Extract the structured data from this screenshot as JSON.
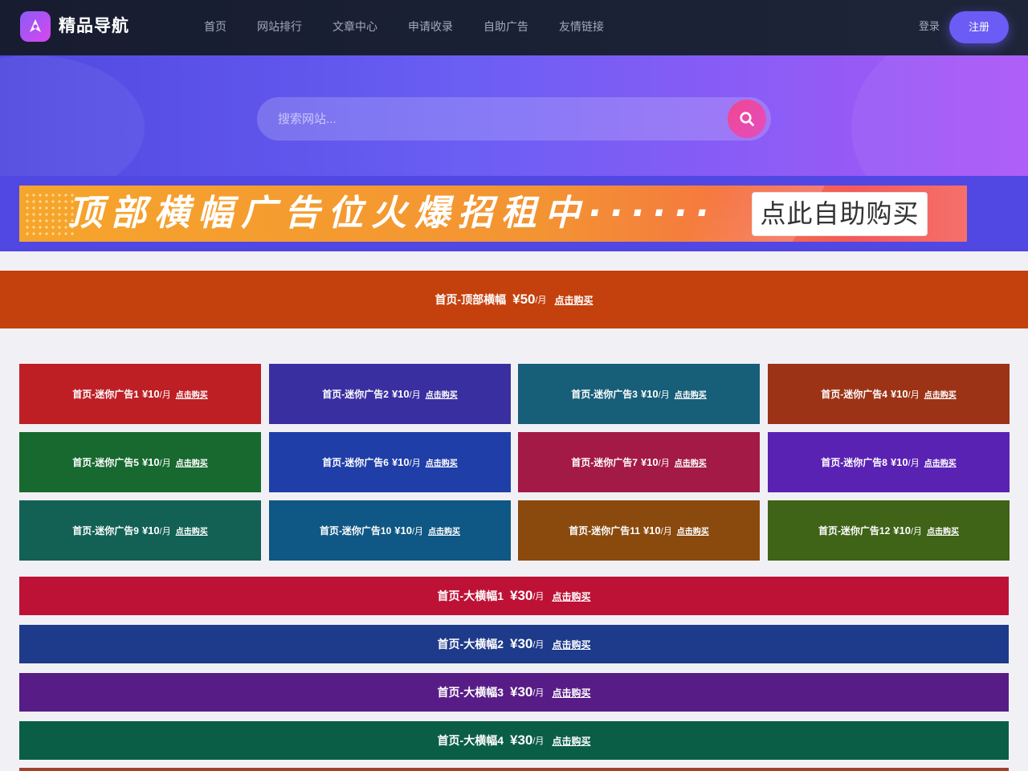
{
  "brand": {
    "name": "精品导航",
    "logo_icon": "rocket-icon",
    "logo_gradient": [
      "#8b5cf6",
      "#d946ef"
    ]
  },
  "nav": {
    "items": [
      "首页",
      "网站排行",
      "文章中心",
      "申请收录",
      "自助广告",
      "友情链接"
    ],
    "login_label": "登录",
    "register_label": "注册"
  },
  "search": {
    "placeholder": "搜索网站...",
    "value": "",
    "button_icon": "search-icon"
  },
  "top_banner": {
    "headline": "顶部横幅广告位火爆招租中······",
    "cta": "点此自助购买"
  },
  "full_banner": {
    "title": "首页-顶部横幅",
    "price": "¥50",
    "unit": "/月",
    "buy": "点击购买",
    "color": "#c4410e"
  },
  "mini_ads": [
    {
      "title": "首页-迷你广告1",
      "price": "¥10",
      "unit": "/月",
      "buy": "点击购买",
      "color": "#bd1f25"
    },
    {
      "title": "首页-迷你广告2",
      "price": "¥10",
      "unit": "/月",
      "buy": "点击购买",
      "color": "#3a2fa1"
    },
    {
      "title": "首页-迷你广告3",
      "price": "¥10",
      "unit": "/月",
      "buy": "点击购买",
      "color": "#175e79"
    },
    {
      "title": "首页-迷你广告4",
      "price": "¥10",
      "unit": "/月",
      "buy": "点击购买",
      "color": "#9d3316"
    },
    {
      "title": "首页-迷你广告5",
      "price": "¥10",
      "unit": "/月",
      "buy": "点击购买",
      "color": "#17692f"
    },
    {
      "title": "首页-迷你广告6",
      "price": "¥10",
      "unit": "/月",
      "buy": "点击购买",
      "color": "#1f3ea8"
    },
    {
      "title": "首页-迷你广告7",
      "price": "¥10",
      "unit": "/月",
      "buy": "点击购买",
      "color": "#a31a46"
    },
    {
      "title": "首页-迷你广告8",
      "price": "¥10",
      "unit": "/月",
      "buy": "点击购买",
      "color": "#5a22b3"
    },
    {
      "title": "首页-迷你广告9",
      "price": "¥10",
      "unit": "/月",
      "buy": "点击购买",
      "color": "#126154"
    },
    {
      "title": "首页-迷你广告10",
      "price": "¥10",
      "unit": "/月",
      "buy": "点击购买",
      "color": "#0f5784"
    },
    {
      "title": "首页-迷你广告11",
      "price": "¥10",
      "unit": "/月",
      "buy": "点击购买",
      "color": "#8a4a0e"
    },
    {
      "title": "首页-迷你广告12",
      "price": "¥10",
      "unit": "/月",
      "buy": "点击购买",
      "color": "#3f6317"
    }
  ],
  "big_ads": [
    {
      "title": "首页-大横幅1",
      "price": "¥30",
      "unit": "/月",
      "buy": "点击购买",
      "color": "#bd1236"
    },
    {
      "title": "首页-大横幅2",
      "price": "¥30",
      "unit": "/月",
      "buy": "点击购买",
      "color": "#1e3a8a"
    },
    {
      "title": "首页-大横幅3",
      "price": "¥30",
      "unit": "/月",
      "buy": "点击购买",
      "color": "#581c87"
    },
    {
      "title": "首页-大横幅4",
      "price": "¥30",
      "unit": "/月",
      "buy": "点击购买",
      "color": "#0b5e46"
    }
  ]
}
